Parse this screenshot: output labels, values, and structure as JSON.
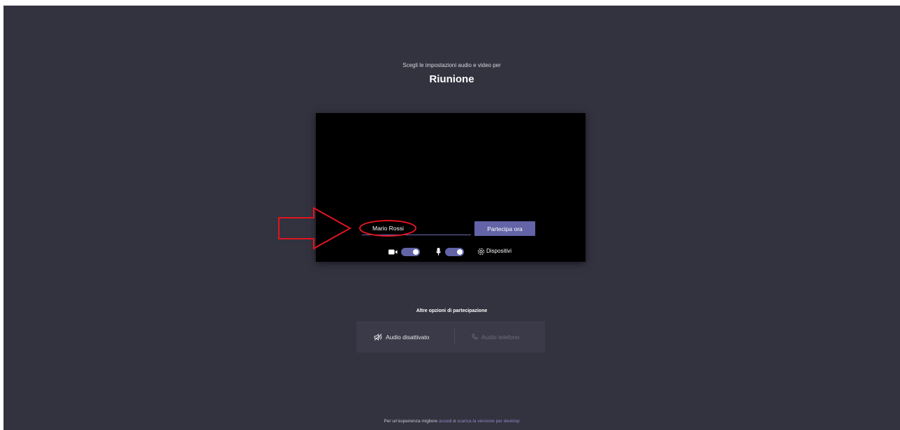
{
  "header": {
    "subtitle": "Scegli le impostazioni audio e video per",
    "meeting_title": "Riunione"
  },
  "join_panel": {
    "name_value": "Mario Rossi",
    "join_button_label": "Partecipa ora",
    "camera_toggle_on": true,
    "mic_toggle_on": true,
    "devices_label": "Dispositivi"
  },
  "other_options": {
    "title": "Altre opzioni di partecipazione",
    "audio_off_label": "Audio disattivato",
    "phone_audio_label": "Audio telefono"
  },
  "footer": {
    "text_before": "Per un'esperienza migliore ",
    "sign_in_link": "accedi",
    "text_middle": " o ",
    "download_link": "scarica la versione per desktop"
  },
  "colors": {
    "background": "#33323f",
    "accent": "#6264a7",
    "annotation": "#e0141e"
  },
  "icons": {
    "camera": "camera-icon",
    "microphone": "microphone-icon",
    "devices": "gear-icon",
    "audio_off": "speaker-off-icon",
    "phone": "phone-icon"
  }
}
